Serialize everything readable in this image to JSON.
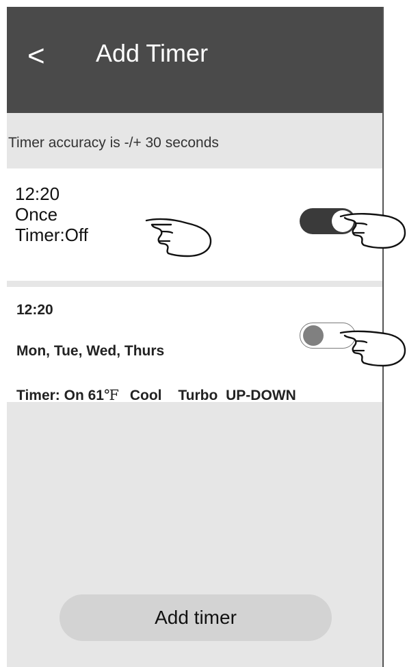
{
  "header": {
    "back_label": "<",
    "title": "Add Timer"
  },
  "accuracy_note": "Timer accuracy is -/+ 30 seconds",
  "timers": [
    {
      "time": "12:20",
      "repeat": "Once",
      "status": "Timer:Off",
      "enabled": true
    },
    {
      "time": "12:20",
      "repeat": "Mon, Tue, Wed, Thurs",
      "status_prefix": "Timer: On 61",
      "unit": "℉",
      "mode": "Cool",
      "fan": "Turbo",
      "swing": "UP-DOWN",
      "enabled": false
    }
  ],
  "add_button_label": "Add timer",
  "icons": {
    "pointer": "pointing-hand-icon"
  },
  "colors": {
    "header_bg": "#4a4a4a",
    "page_bg": "#e6e6e6",
    "card_bg": "#ffffff",
    "toggle_on": "#3a3a3a",
    "toggle_off_knob": "#808080",
    "button_bg": "#d3d3d3"
  }
}
